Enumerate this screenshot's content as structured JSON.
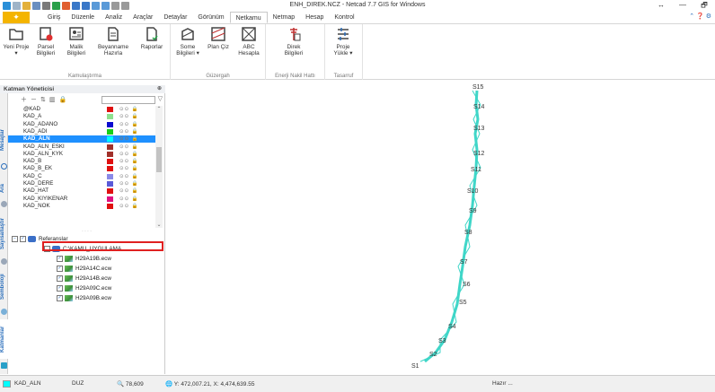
{
  "window": {
    "title": "ENH_DIREK.NCZ - Netcad 7.7 GIS for Windows",
    "controls": [
      "↔",
      "—",
      "🗗"
    ]
  },
  "ribbon_tabs": [
    {
      "label": "Giriş"
    },
    {
      "label": "Düzenle"
    },
    {
      "label": "Analiz"
    },
    {
      "label": "Araçlar"
    },
    {
      "label": "Detaylar"
    },
    {
      "label": "Görünüm"
    },
    {
      "label": "Netkamu",
      "active": true
    },
    {
      "label": "Netmap"
    },
    {
      "label": "Hesap"
    },
    {
      "label": "Kontrol"
    }
  ],
  "ribbon_groups": {
    "kamulastirma": {
      "label": "Kamulaştırma",
      "buttons": [
        {
          "label": "Yeni Proje ▾",
          "icon": "folder-icon"
        },
        {
          "label": "Parsel Bilgileri",
          "icon": "parcel-info-icon"
        },
        {
          "label": "Malik Bilgileri",
          "icon": "owner-info-icon"
        },
        {
          "label": "Beyanname Hazırla",
          "icon": "declaration-icon"
        },
        {
          "label": "Raporlar",
          "icon": "report-icon"
        }
      ]
    },
    "guzergah": {
      "label": "Güzergah",
      "buttons": [
        {
          "label": "Some Bilgileri ▾",
          "icon": "some-info-icon"
        },
        {
          "label": "Plan Çiz",
          "icon": "plan-draw-icon"
        },
        {
          "label": "ABC Hesapla",
          "icon": "abc-calc-icon"
        }
      ]
    },
    "enerji": {
      "label": "Enerji Nakil Hattı",
      "buttons": [
        {
          "label": "Direk Bilgileri",
          "icon": "pole-info-icon"
        }
      ]
    },
    "tasarruf": {
      "label": "Tasarruf",
      "buttons": [
        {
          "label": "Proje Yükle ▾",
          "icon": "project-load-icon"
        }
      ]
    }
  },
  "side_tabs": [
    "Mesajlar",
    "Ara",
    "Sayısallaştır",
    "Semboloji",
    "Katmanlar"
  ],
  "layer_manager": {
    "title": "Katman Yöneticisi",
    "search_value": "",
    "layers": [
      {
        "name": "@KAD",
        "color": "#e01010"
      },
      {
        "name": "KAD_A",
        "color": "#8fe08f"
      },
      {
        "name": "KAD_ADANO",
        "color": "#0b0bcf"
      },
      {
        "name": "KAD_ADI",
        "color": "#19d019"
      },
      {
        "name": "KAD_ALN",
        "color": "#00ffff",
        "selected": true
      },
      {
        "name": "KAD_ALN_ESKI",
        "color": "#a0302a"
      },
      {
        "name": "KAD_ALN_KYK",
        "color": "#a0302a"
      },
      {
        "name": "KAD_B",
        "color": "#e01010"
      },
      {
        "name": "KAD_B_EK",
        "color": "#e01010"
      },
      {
        "name": "KAD_C",
        "color": "#8a8ae8"
      },
      {
        "name": "KAD_DERE",
        "color": "#5a5ad8"
      },
      {
        "name": "KAD_HAT",
        "color": "#e01010"
      },
      {
        "name": "KAD_KIYIKENAR",
        "color": "#e01080"
      },
      {
        "name": "KAD_NOK",
        "color": "#e01010"
      }
    ],
    "flags": "⊙⊙ 🔒",
    "references": {
      "label": "Referanslar",
      "db_path": "C:\\KAMU_UYGULAMA",
      "images": [
        "H29A19B.ecw",
        "H29A14C.ecw",
        "H29A14B.ecw",
        "H29A09C.ecw",
        "H29A09B.ecw"
      ]
    }
  },
  "map": {
    "line_color": "#3fd6c8",
    "poles": [
      "S1",
      "S2",
      "S3",
      "S4",
      "S5",
      "S6",
      "S7",
      "S8",
      "S9",
      "S10",
      "S11",
      "S12",
      "S13",
      "S14",
      "S15"
    ]
  },
  "status_bar": {
    "layer": "KAD_ALN",
    "mode": "DUZ",
    "zoom": "78,609",
    "coords": "Y: 472,007.21, X: 4,474,639.55",
    "state": "Hazır ..."
  }
}
